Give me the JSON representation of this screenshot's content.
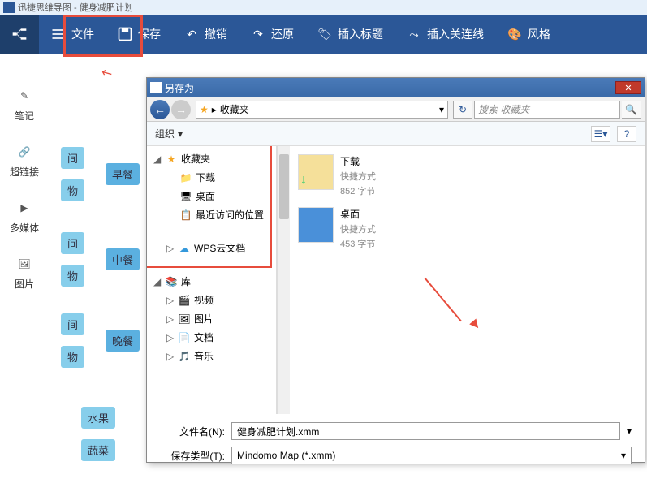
{
  "app": {
    "title": "迅捷思维导图 - 健身减肥计划"
  },
  "toolbar": {
    "mindmap": "",
    "file": "文件",
    "save": "保存",
    "undo": "撤销",
    "redo": "还原",
    "insert_title": "插入标题",
    "insert_connector": "插入关连线",
    "style": "风格"
  },
  "sidebar": {
    "note": "笔记",
    "hyperlink": "超链接",
    "multimedia": "多媒体",
    "image": "图片"
  },
  "mindmap": {
    "nodes": {
      "time1": "间",
      "things1": "物",
      "breakfast": "早餐",
      "time2": "间",
      "things2": "物",
      "lunch": "中餐",
      "time3": "间",
      "things3": "物",
      "dinner": "晚餐",
      "fruit": "水果",
      "vegetable": "蔬菜"
    }
  },
  "dialog": {
    "title": "另存为",
    "breadcrumb": "收藏夹",
    "search_placeholder": "搜索 收藏夹",
    "organize": "组织",
    "tree": {
      "favorites": "收藏夹",
      "downloads": "下载",
      "desktop": "桌面",
      "recent": "最近访问的位置",
      "wps": "WPS云文档",
      "library": "库",
      "video": "视频",
      "pictures": "图片",
      "documents": "文档",
      "music": "音乐"
    },
    "content": {
      "item1": {
        "name": "下载",
        "type": "快捷方式",
        "size": "852 字节"
      },
      "item2": {
        "name": "桌面",
        "type": "快捷方式",
        "size": "453 字节"
      }
    },
    "filename_label": "文件名(N):",
    "filename_value": "健身减肥计划.xmm",
    "filetype_label": "保存类型(T):",
    "filetype_value": "Mindomo Map (*.xmm)"
  }
}
